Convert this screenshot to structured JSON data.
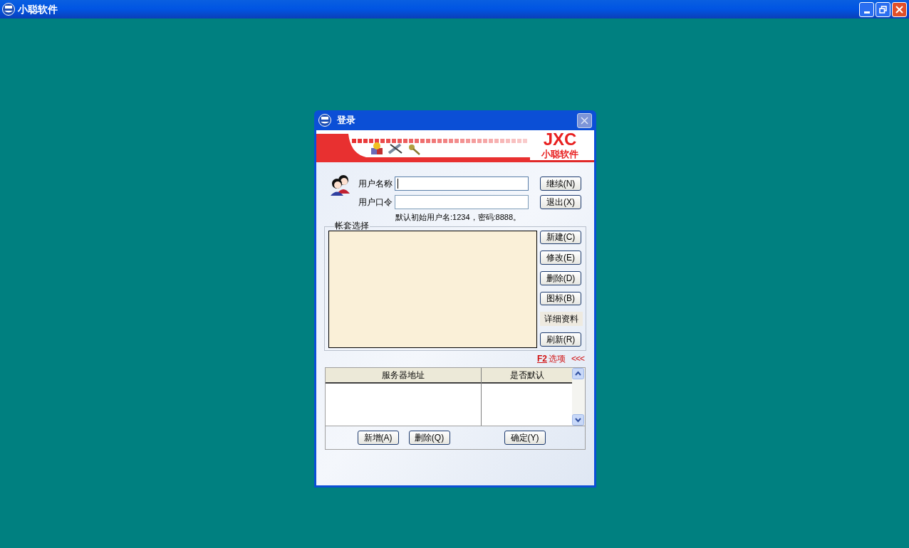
{
  "window": {
    "title": "小聪软件"
  },
  "dialog": {
    "title": "登录",
    "banner": {
      "brand": "JXC",
      "subtitle": "小聪软件"
    },
    "fields": [
      {
        "label": "用户名称",
        "focused": true
      },
      {
        "label": "用户口令",
        "focused": false
      }
    ],
    "side_buttons": [
      "继续(N)",
      "退出(X)"
    ],
    "hint": "默认初始用户名:1234，密码:8888。",
    "accounts": {
      "title": "帐套选择",
      "buttons": [
        {
          "kind": "button",
          "label": "新建(C)"
        },
        {
          "kind": "button",
          "label": "修改(E)"
        },
        {
          "kind": "button",
          "label": "删除(D)"
        },
        {
          "kind": "button",
          "label": "图标(B)"
        },
        {
          "kind": "label",
          "label": "详细资料"
        },
        {
          "kind": "button",
          "label": "刷新(R)"
        }
      ]
    },
    "options": {
      "key": "F2",
      "label": "选项",
      "arrows": "<<<"
    },
    "servers": {
      "columns": [
        "服务器地址",
        "是否默认"
      ],
      "buttons": [
        "新增(A)",
        "删除(Q)"
      ],
      "confirm": "确定(Y)"
    }
  }
}
